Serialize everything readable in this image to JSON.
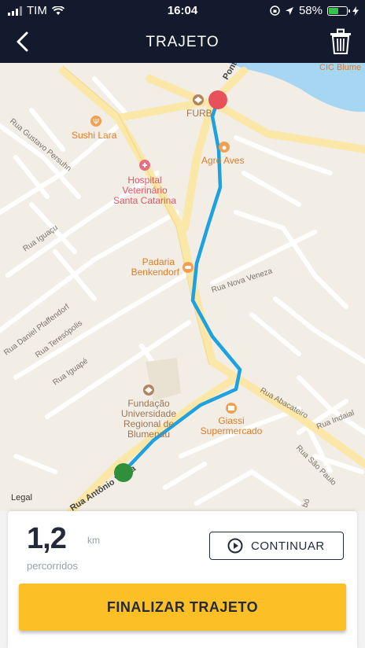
{
  "status_bar": {
    "carrier": "TIM",
    "time": "16:04",
    "battery_percent": "58%",
    "battery_level": 0.58,
    "battery_color": "#33c24d"
  },
  "header": {
    "title": "TRAJETO",
    "background": "#141a2e"
  },
  "map": {
    "legal": "Legal",
    "route_color": "#1da1e0",
    "start_marker_color": "#2f8f3a",
    "end_marker_color": "#e8505b",
    "pois": {
      "sushi": "Sushi Lara",
      "furb": "FURB",
      "agro": "Agro Aves",
      "hospital_1": "Hospital",
      "hospital_2": "Veterinário",
      "hospital_3": "Santa Catarina",
      "padaria_1": "Padaria",
      "padaria_2": "Benkendorf",
      "fundacao_1": "Fundação",
      "fundacao_2": "Universidade",
      "fundacao_3": "Regional de",
      "fundacao_4": "Blumenau",
      "giassi_1": "Giassi",
      "giassi_2": "Supermercado",
      "cic": "CIC Blume"
    },
    "streets": {
      "gustavo": "Rua Gustavo Persuhn",
      "iguacu": "Rua Iguaçu",
      "daniel": "Rua Daniel Pfaffendorf",
      "teresopolis": "Rua Teresópolis",
      "iguape": "Rua Iguapé",
      "nova_veneza": "Rua Nova Veneza",
      "abacateiro": "Rua Abacateiro",
      "indaial": "Rua Indaial",
      "sao_paulo": "Rua São Paulo",
      "antonio": "Rua Antônio Veiga",
      "ponte": "Ponte",
      "bo": "bó"
    }
  },
  "summary": {
    "distance_value": "1,2",
    "distance_unit": "km",
    "distance_label": "percorridos",
    "continue_label": "CONTINUAR",
    "finish_label": "FINALIZAR TRAJETO",
    "accent": "#fcbf26"
  }
}
